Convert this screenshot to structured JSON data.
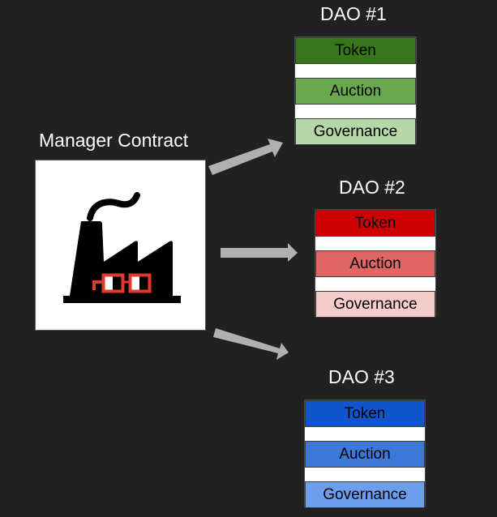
{
  "manager": {
    "title": "Manager Contract",
    "icon": "factory-with-glasses-icon",
    "icon_colors": {
      "body": "#000000",
      "glasses": "#e03a2a"
    }
  },
  "arrow_color": "#b0b0b0",
  "daos": [
    {
      "title": "DAO #1",
      "modules": [
        {
          "label": "Token",
          "color": "#38761d"
        },
        {
          "label": "Auction",
          "color": "#6aa84f"
        },
        {
          "label": "Governance",
          "color": "#b6d7a8"
        }
      ]
    },
    {
      "title": "DAO #2",
      "modules": [
        {
          "label": "Token",
          "color": "#cc0000"
        },
        {
          "label": "Auction",
          "color": "#e06666"
        },
        {
          "label": "Governance",
          "color": "#f4cccc"
        }
      ]
    },
    {
      "title": "DAO #3",
      "modules": [
        {
          "label": "Token",
          "color": "#1155cc"
        },
        {
          "label": "Auction",
          "color": "#3c78d8"
        },
        {
          "label": "Governance",
          "color": "#6d9eeb"
        }
      ]
    }
  ]
}
